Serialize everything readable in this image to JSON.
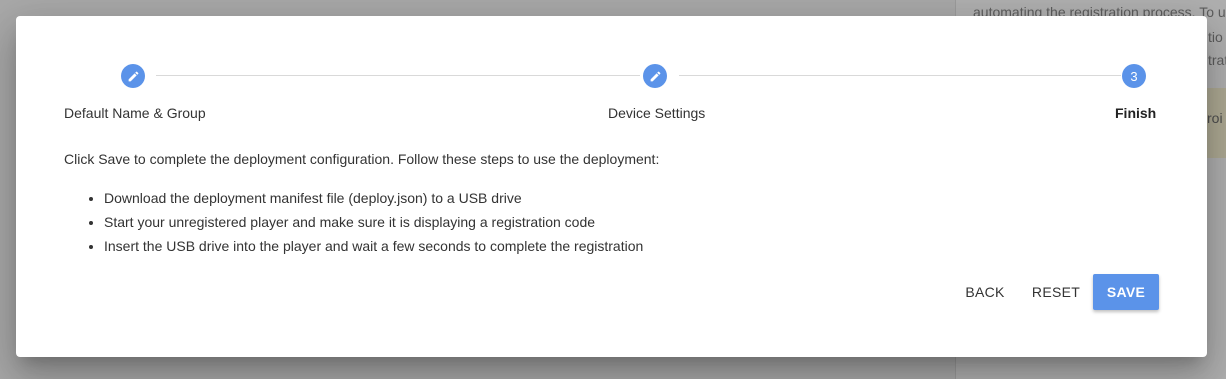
{
  "background": {
    "line1": "automating the registration process. To u",
    "line2": "tio",
    "line3": "trat",
    "band_text": "roi"
  },
  "stepper": {
    "steps": [
      {
        "label": "Default Name & Group",
        "state": "completed",
        "icon": "pencil-icon"
      },
      {
        "label": "Device Settings",
        "state": "completed",
        "icon": "pencil-icon"
      },
      {
        "label": "Finish",
        "state": "active",
        "number": "3"
      }
    ]
  },
  "content": {
    "intro": "Click Save to complete the deployment configuration. Follow these steps to use the deployment:",
    "items": [
      "Download the deployment manifest file (deploy.json) to a USB drive",
      "Start your unregistered player and make sure it is displaying a registration code",
      "Insert the USB drive into the player and wait a few seconds to complete the registration"
    ]
  },
  "actions": {
    "back_label": "BACK",
    "reset_label": "RESET",
    "save_label": "SAVE"
  },
  "colors": {
    "accent": "#5b93e9",
    "overlay": "#a9a9a9"
  }
}
